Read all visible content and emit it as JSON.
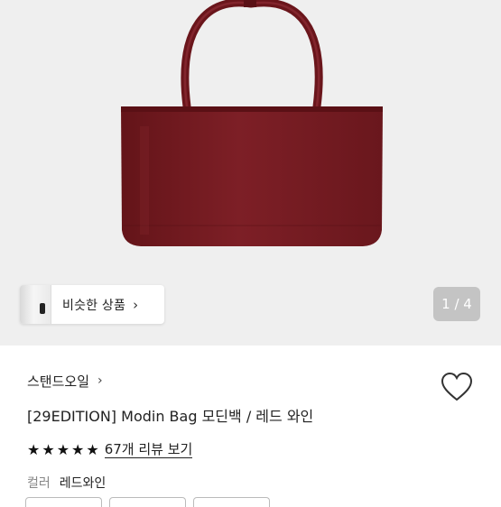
{
  "gallery": {
    "similar_label": "비슷한 상품",
    "counter": "1 / 4"
  },
  "product": {
    "brand": "스탠드오일",
    "title": "[29EDITION] Modin Bag 모딘백 / 레드 와인",
    "rating": 5,
    "review_link": "67개 리뷰 보기",
    "color_label": "컬러",
    "color_value": "레드와인"
  },
  "colors": {
    "bag": "#7a1e24",
    "hero_bg": "#efefef"
  },
  "icons": {
    "heart": "heart-outline-icon",
    "star": "star-filled-icon",
    "chevron": "chevron-right-icon"
  }
}
